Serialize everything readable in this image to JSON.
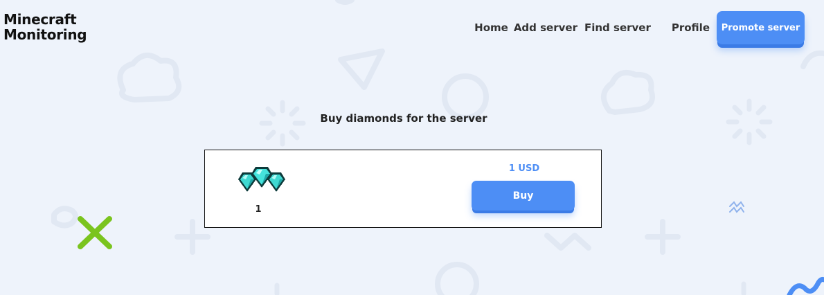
{
  "header": {
    "logo_line1": "Minecraft",
    "logo_line2": "Monitoring",
    "nav": {
      "home": "Home",
      "add_server": "Add server",
      "find_server": "Find server",
      "profile": "Profile",
      "promote_server": "Promote server"
    }
  },
  "main": {
    "heading": "Buy diamonds for the server",
    "product": {
      "icon": "diamonds-icon",
      "quantity": "1",
      "price": "1 USD",
      "buy_label": "Buy"
    }
  },
  "colors": {
    "background": "#eef3fb",
    "accent": "#4d8ef5",
    "text": "#222222",
    "decor_green": "#7ac41e"
  }
}
